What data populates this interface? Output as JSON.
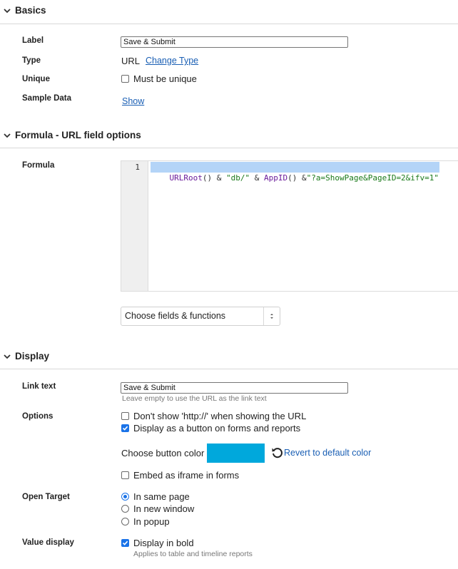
{
  "sections": {
    "basics": {
      "title": "Basics"
    },
    "formula": {
      "title": "Formula - URL field options"
    },
    "display": {
      "title": "Display"
    }
  },
  "basics": {
    "label": {
      "label": "Label",
      "value": "Save & Submit"
    },
    "type": {
      "label": "Type",
      "value": "URL",
      "change_link": "Change Type"
    },
    "unique": {
      "label": "Unique",
      "checkbox_label": "Must be unique",
      "checked": false
    },
    "sample": {
      "label": "Sample Data",
      "link": "Show"
    }
  },
  "formula": {
    "label": "Formula",
    "line_number": "1",
    "tokens": {
      "t1": "URLRoot",
      "t2": "() & ",
      "t3": "\"db/\"",
      "t4": " & ",
      "t5": "AppID",
      "t6": "() &",
      "t7": "\"?a=ShowPage&PageID=2&ifv=1\""
    },
    "select_label": "Choose fields & functions"
  },
  "display": {
    "link_text": {
      "label": "Link text",
      "value": "Save & Submit",
      "hint": "Leave empty to use the URL as the link text"
    },
    "options": {
      "label": "Options",
      "no_http": {
        "label": "Don't show 'http://' when showing the URL",
        "checked": false
      },
      "as_button": {
        "label": "Display as a button on forms and reports",
        "checked": true
      },
      "button_color_label": "Choose button color",
      "button_color": "#00a8dc",
      "revert_label": "Revert to default color",
      "embed_iframe": {
        "label": "Embed as iframe in forms",
        "checked": false
      }
    },
    "open_target": {
      "label": "Open Target",
      "same_page": "In same page",
      "new_window": "In new window",
      "popup": "In popup",
      "selected": "same_page"
    },
    "value_display": {
      "label": "Value display",
      "bold": {
        "label": "Display in bold",
        "checked": true,
        "hint": "Applies to table and timeline reports"
      }
    }
  },
  "colors": {
    "accent": "#1a73e8",
    "link": "#1a5fb4",
    "selection": "#b4d4f7"
  }
}
